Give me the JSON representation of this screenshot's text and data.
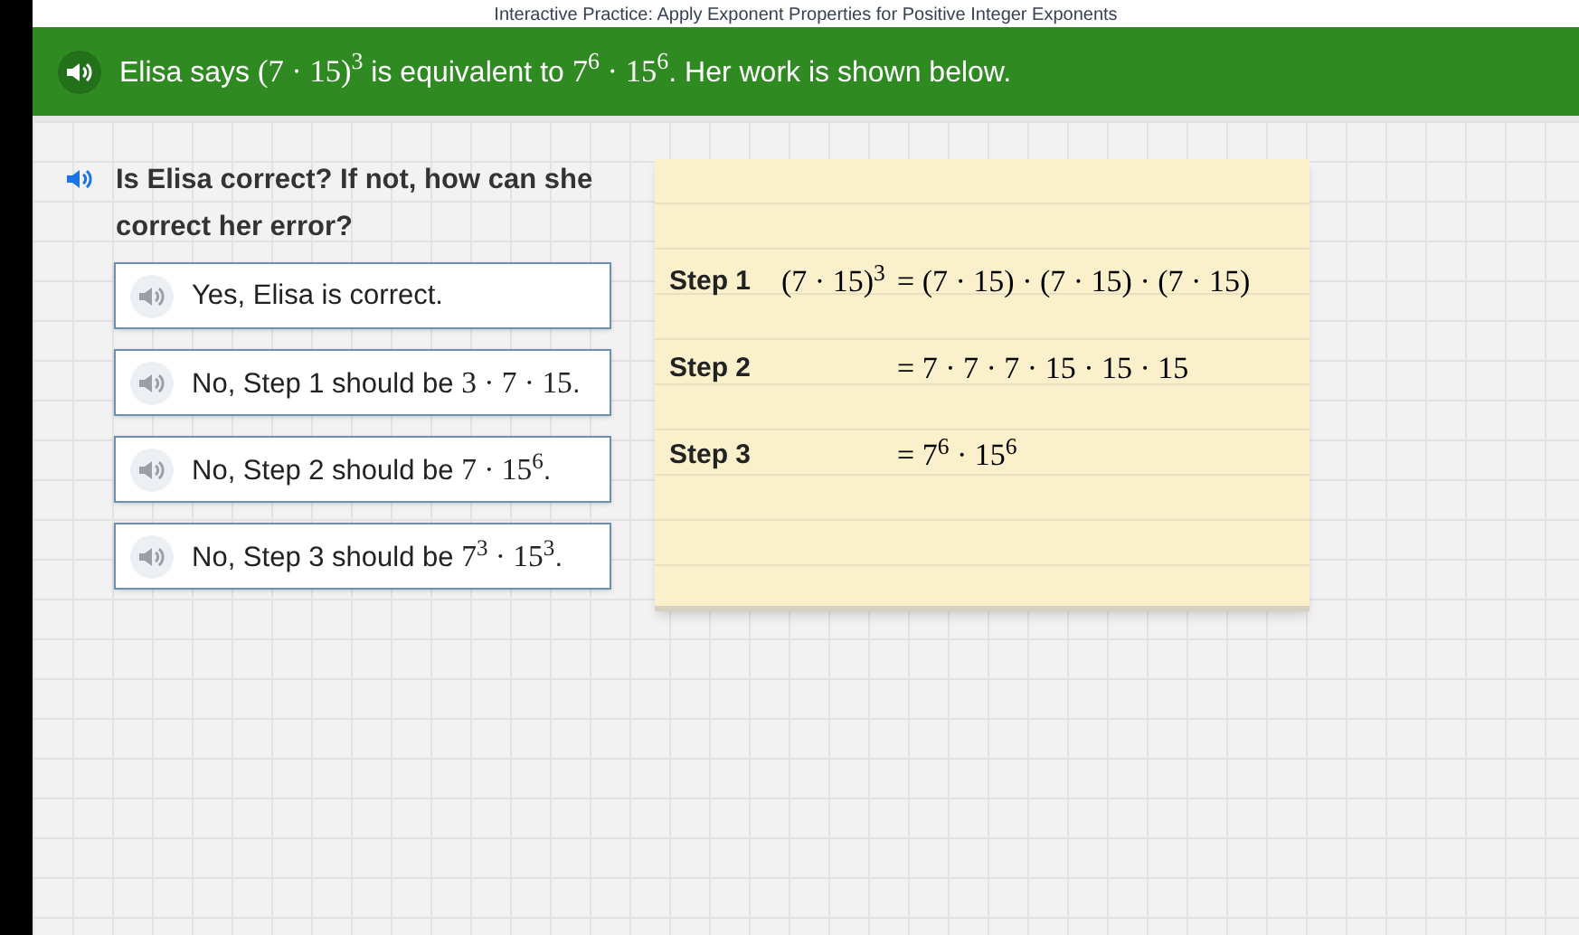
{
  "window": {
    "title": "Interactive Practice: Apply Exponent Properties for Positive Integer Exponents"
  },
  "prompt": {
    "segments": [
      {
        "kind": "text",
        "text": "Elisa says "
      },
      {
        "kind": "math",
        "text": "(7 · 15)$^{3}$"
      },
      {
        "kind": "text",
        "text": " is equivalent to "
      },
      {
        "kind": "math",
        "text": "7$^{6}$ · 15$^{6}$"
      },
      {
        "kind": "text",
        "text": ". Her work is shown below."
      }
    ]
  },
  "question": {
    "text": "Is Elisa correct? If not, how can she correct her error?"
  },
  "options": [
    {
      "segments": [
        {
          "kind": "text",
          "text": "Yes, Elisa is correct."
        }
      ],
      "selected": false
    },
    {
      "segments": [
        {
          "kind": "text",
          "text": "No, Step 1 should be "
        },
        {
          "kind": "math",
          "text": "3 · 7 · 15"
        },
        {
          "kind": "text",
          "text": "."
        }
      ],
      "selected": false
    },
    {
      "segments": [
        {
          "kind": "text",
          "text": "No, Step 2 should be "
        },
        {
          "kind": "math",
          "text": "7 · 15$^{6}$"
        },
        {
          "kind": "text",
          "text": "."
        }
      ],
      "selected": false
    },
    {
      "segments": [
        {
          "kind": "text",
          "text": "No, Step 3 should be "
        },
        {
          "kind": "math",
          "text": "7$^{3}$ · 15$^{3}$"
        },
        {
          "kind": "text",
          "text": "."
        }
      ],
      "selected": false
    }
  ],
  "work": {
    "steps": [
      {
        "label": "Step 1",
        "lhs": "(7 · 15)$^{3}$",
        "rhs": "= (7 · 15) · (7 · 15) · (7 · 15)"
      },
      {
        "label": "Step 2",
        "rhs": "= 7 · 7 · 7 · 15 · 15 · 15"
      },
      {
        "label": "Step 3",
        "rhs": "= 7$^{6}$ · 15$^{6}$"
      }
    ]
  }
}
